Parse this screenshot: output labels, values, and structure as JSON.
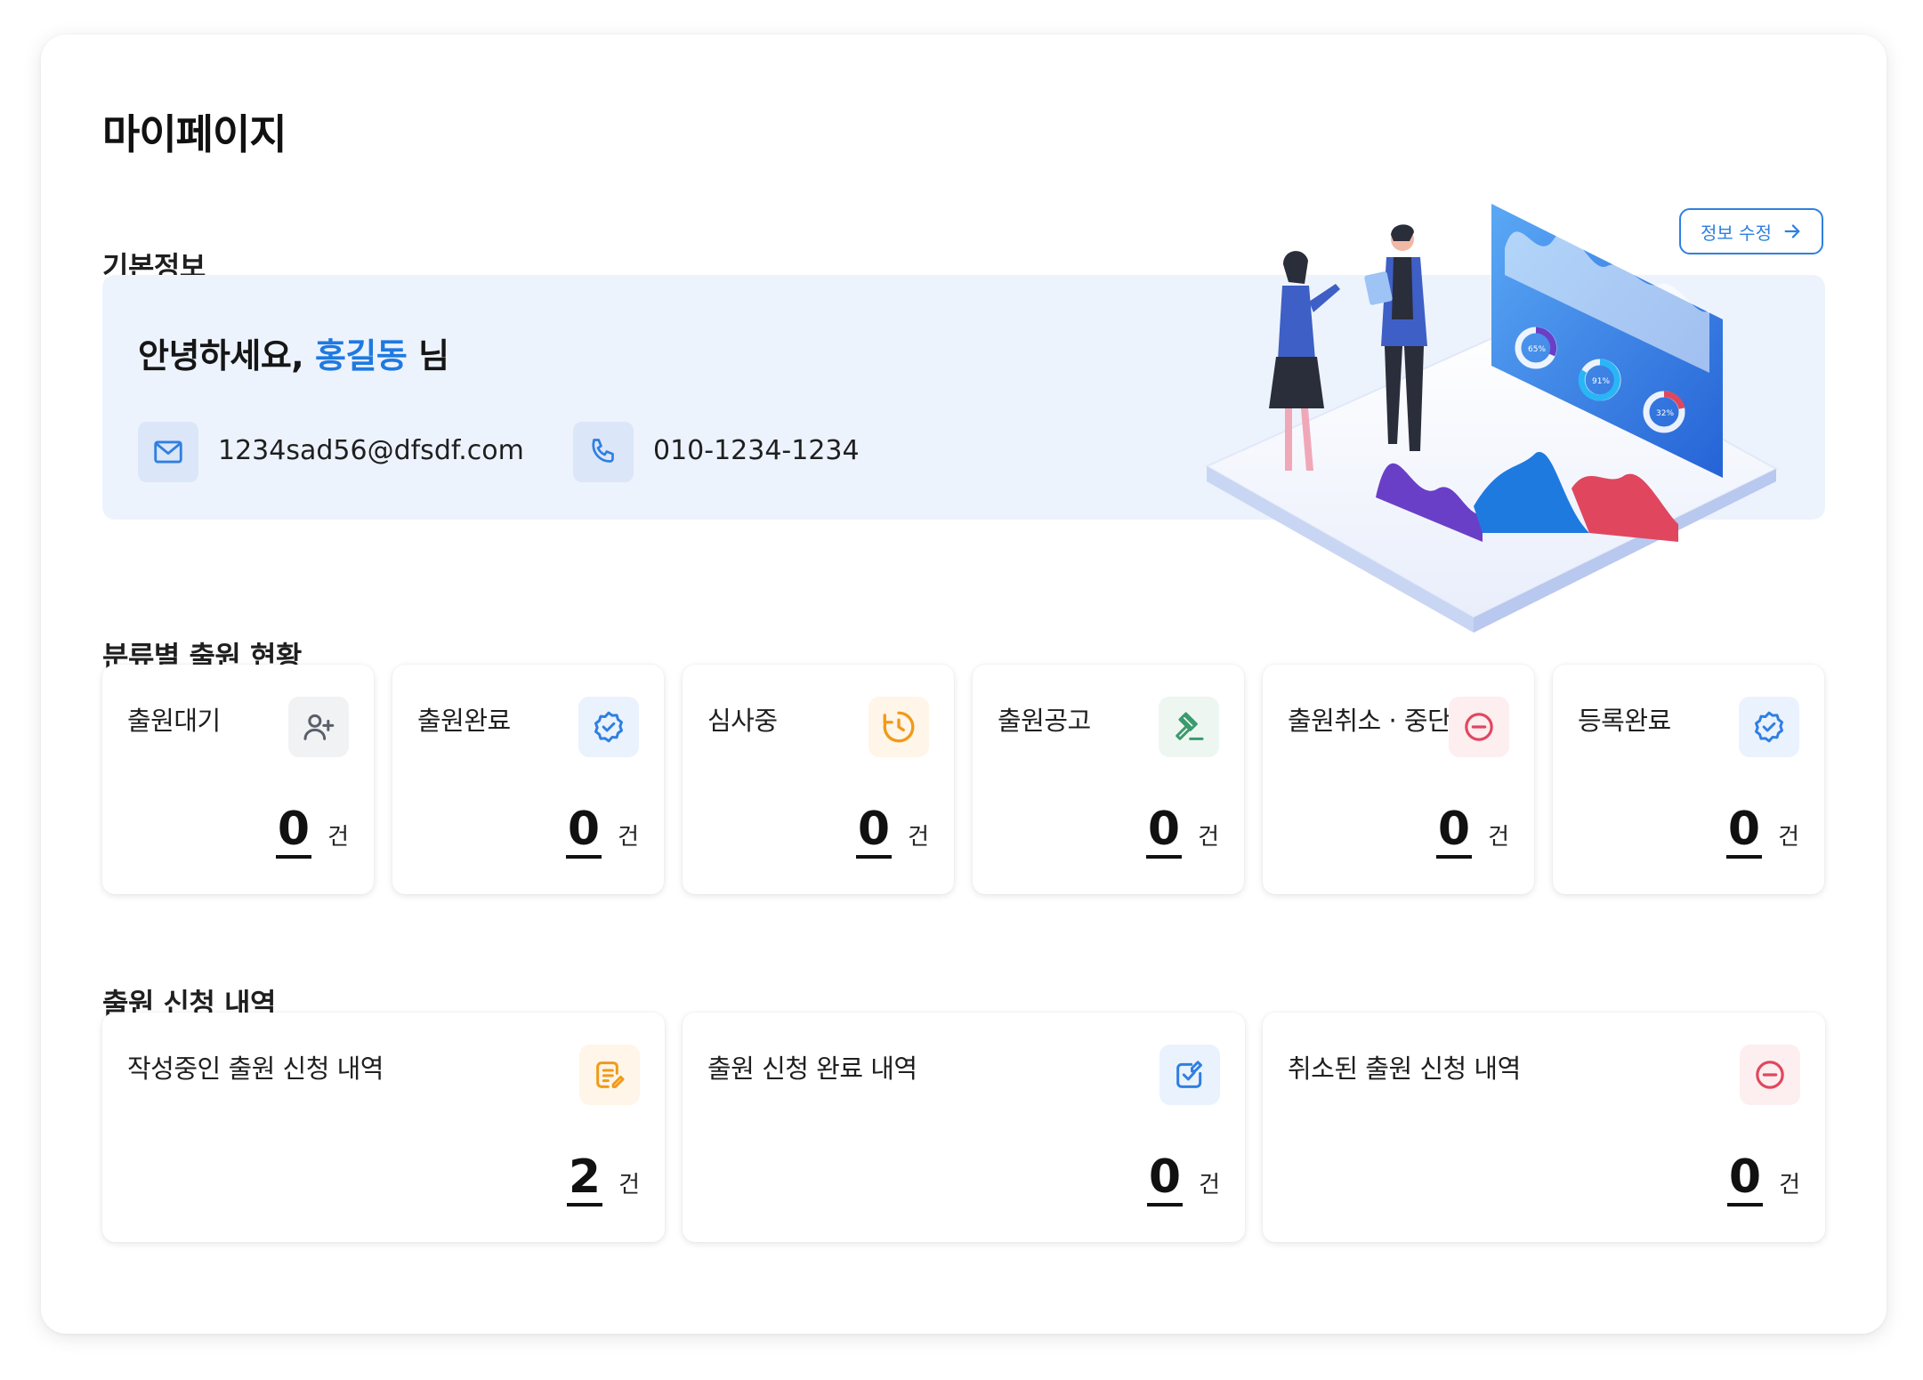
{
  "page": {
    "title": "마이페이지"
  },
  "basic_info": {
    "section_title": "기본정보",
    "greeting_prefix": "안녕하세요, ",
    "user_name": "홍길동",
    "greeting_suffix": " 님",
    "email": "1234sad56@dfsdf.com",
    "phone": "010-1234-1234",
    "edit_label": "정보 수정",
    "illustration_labels": [
      "65%",
      "91%",
      "32%"
    ]
  },
  "category_status": {
    "section_title": "분류별 출원 현황",
    "cards": [
      {
        "label": "출원대기",
        "count": "0",
        "unit": "건",
        "icon": "user-add-icon",
        "icon_color": "#5a5f6a",
        "icon_bg": "#f1f2f4"
      },
      {
        "label": "출원완료",
        "count": "0",
        "unit": "건",
        "icon": "badge-check-icon",
        "icon_color": "#2f7fe0",
        "icon_bg": "#eaf2fd"
      },
      {
        "label": "심사중",
        "count": "0",
        "unit": "건",
        "icon": "clock-icon",
        "icon_color": "#f09a1a",
        "icon_bg": "#fff5e8"
      },
      {
        "label": "출원공고",
        "count": "0",
        "unit": "건",
        "icon": "gavel-icon",
        "icon_color": "#3b9a6e",
        "icon_bg": "#eef6f1"
      },
      {
        "label": "출원취소 · 중단",
        "count": "0",
        "unit": "건",
        "icon": "minus-circle-icon",
        "icon_color": "#e0475e",
        "icon_bg": "#fdeef0"
      },
      {
        "label": "등록완료",
        "count": "0",
        "unit": "건",
        "icon": "badge-check-icon",
        "icon_color": "#2f7fe0",
        "icon_bg": "#eaf2fd"
      }
    ]
  },
  "application_history": {
    "section_title": "출원 신청 내역",
    "cards": [
      {
        "label": "작성중인 출원 신청 내역",
        "count": "2",
        "unit": "건",
        "icon": "document-edit-icon",
        "icon_color": "#f09a1a",
        "icon_bg": "#fff5e8"
      },
      {
        "label": "출원 신청 완료 내역",
        "count": "0",
        "unit": "건",
        "icon": "checkbox-edit-icon",
        "icon_color": "#2f7fe0",
        "icon_bg": "#eaf2fd"
      },
      {
        "label": "취소된 출원 신청 내역",
        "count": "0",
        "unit": "건",
        "icon": "minus-circle-icon",
        "icon_color": "#e0475e",
        "icon_bg": "#fdeef0"
      }
    ]
  }
}
